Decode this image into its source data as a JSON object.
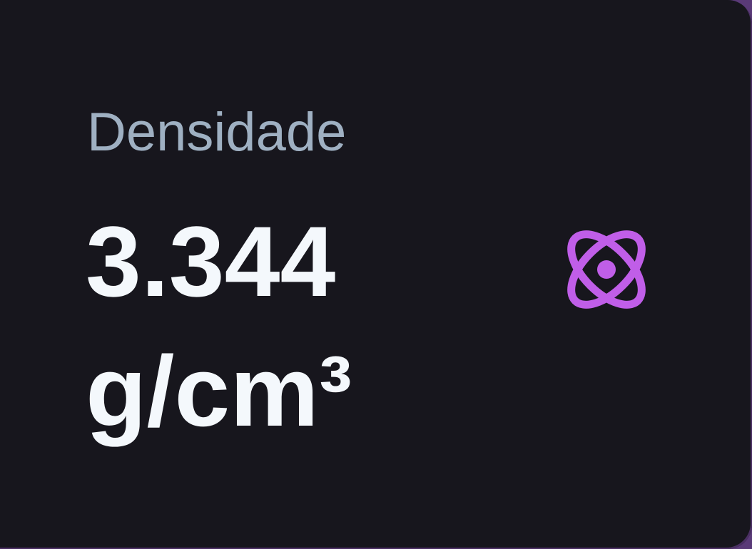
{
  "card": {
    "label": "Densidade",
    "value": "3.344 g/cm³",
    "icon": "atom-icon",
    "accent_color": "#c05ee8",
    "background_color": "#17161d",
    "label_color": "#9fb0c2",
    "value_color": "#f4f8fc"
  }
}
